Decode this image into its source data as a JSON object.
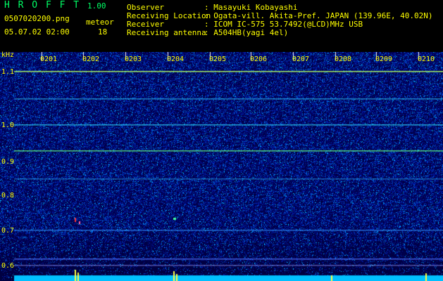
{
  "header": {
    "app_name": "H R O F F T",
    "version": "1.00",
    "filename": "0507020200.png",
    "mode_label": "meteor",
    "datetime": "05.07.02 02:00",
    "meteor_count": "18",
    "info": [
      {
        "label": "Observer",
        "value": ": Masayuki Kobayashi"
      },
      {
        "label": "Receiving Location",
        "value": ": Ogata-vill. Akita-Pref. JAPAN (139.96E, 40.02N)"
      },
      {
        "label": "Receiver",
        "value": ": ICOM IC-575 53.7492(@LCD)MHz USB"
      },
      {
        "label": "Receiving antenna",
        "value": ": A504HB(yagi 4el)"
      }
    ]
  },
  "axis": {
    "unit": "kHz",
    "y_ticks": [
      "1.1",
      "1.0",
      "0.9",
      "0.8",
      "0.7",
      "0.6"
    ],
    "x_ticks": [
      "0201",
      "0202",
      "0203",
      "0204",
      "0205",
      "0206",
      "0207",
      "0208",
      "0209",
      "0210"
    ]
  },
  "colors": {
    "label_green": "#00ff66",
    "label_yellow": "#ffff00",
    "background": "#000000"
  }
}
